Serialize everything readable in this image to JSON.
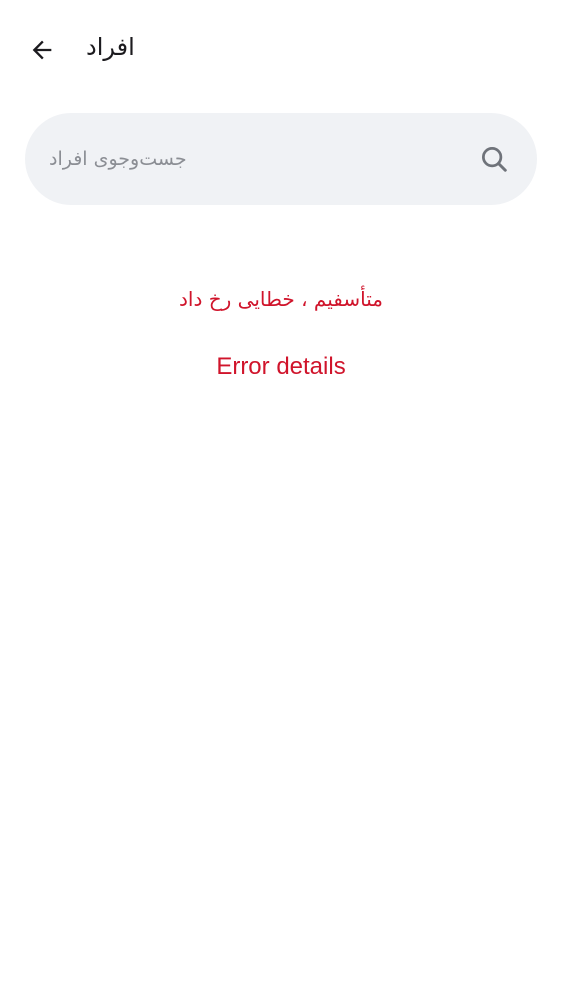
{
  "header": {
    "title": "افراد",
    "back_icon": "arrow-left-icon"
  },
  "search": {
    "placeholder": "جست‌وجوی افراد",
    "value": "",
    "icon": "search-icon"
  },
  "error": {
    "message": "متأسفیم ، خطایی رخ داد",
    "details_label": "Error details",
    "color": "#d0142b"
  },
  "colors": {
    "background": "#ffffff",
    "search_background": "#f0f2f5",
    "title_text": "#1c1b1f",
    "placeholder_text": "#8b8e94"
  }
}
